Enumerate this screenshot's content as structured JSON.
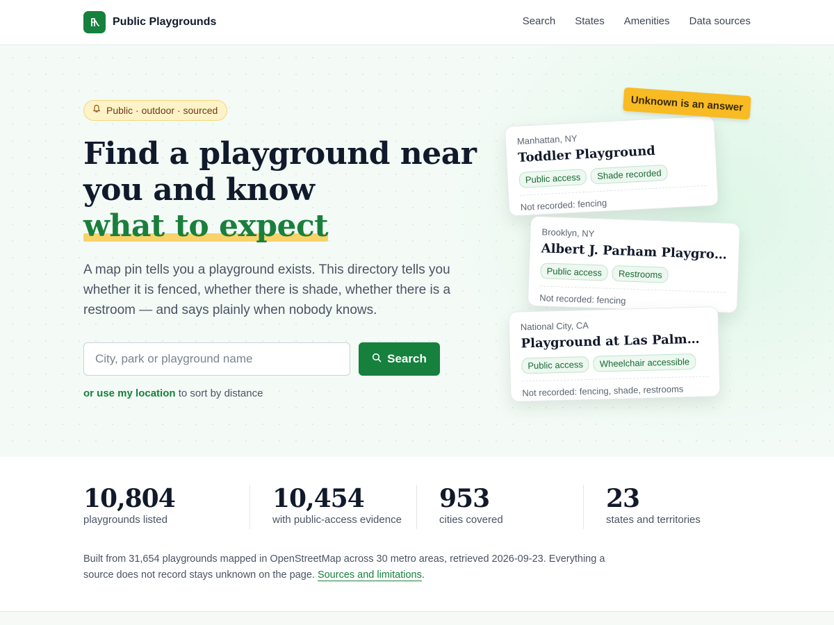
{
  "header": {
    "brand": "Public Playgrounds",
    "brand_icon": "playground-slide-icon",
    "nav": [
      "Search",
      "States",
      "Amenities",
      "Data sources"
    ]
  },
  "hero": {
    "pill": {
      "icon": "bell-icon",
      "text": "Public · outdoor · sourced"
    },
    "headline": {
      "line1": "Find a playground near",
      "line2": "you and know",
      "accent": "what to expect"
    },
    "lede": "A map pin tells you a playground exists. This directory tells you whether it is fenced, whether there is shade, whether there is a restroom — and says plainly when nobody knows.",
    "search": {
      "placeholder": "City, park or playground name",
      "value": "",
      "button": "Search"
    },
    "location": {
      "link": "or use my location",
      "suffix": " to sort by distance"
    },
    "tag": "Unknown is an answer",
    "cards": [
      {
        "city": "Manhattan, NY",
        "name": "Toddler Playground",
        "badges": [
          "Public access",
          "Shade recorded"
        ],
        "note": "Not recorded: fencing"
      },
      {
        "city": "Brooklyn, NY",
        "name": "Albert J. Parham Playground",
        "badges": [
          "Public access",
          "Restrooms"
        ],
        "note": "Not recorded: fencing"
      },
      {
        "city": "National City, CA",
        "name": "Playground at Las Palmas Pa...",
        "badges": [
          "Public access",
          "Wheelchair accessible"
        ],
        "note": "Not recorded: fencing, shade, restrooms"
      }
    ]
  },
  "stats": [
    {
      "value": "10,804",
      "label": "playgrounds listed"
    },
    {
      "value": "10,454",
      "label": "with public-access evidence"
    },
    {
      "value": "953",
      "label": "cities covered"
    },
    {
      "value": "23",
      "label": "states and territories"
    }
  ],
  "footnote": {
    "text": "Built from 31,654 playgrounds mapped in OpenStreetMap across 30 metro areas, retrieved 2026-09-23. Everything a source does not record stays unknown on the page. ",
    "link": "Sources and limitations",
    "end": "."
  },
  "colors": {
    "brand_green": "#16803d",
    "accent_yellow": "#f8bb23",
    "highlight": "#f8d36b",
    "heading": "#111a2b"
  }
}
